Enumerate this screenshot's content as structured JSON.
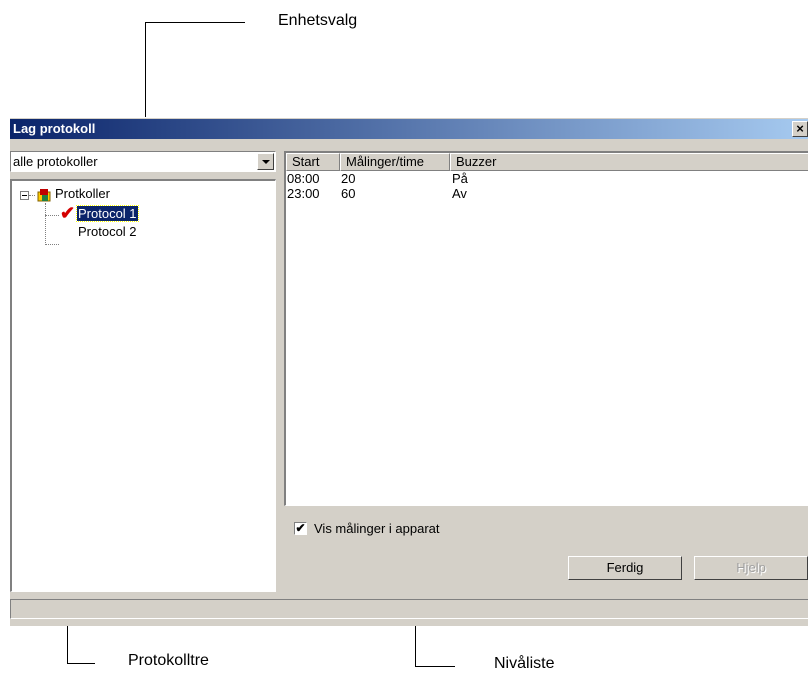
{
  "callouts": {
    "unit_select": "Enhetsvalg",
    "protocol_tree": "Protokolltre",
    "level_list": "Nivåliste"
  },
  "window": {
    "title": "Lag protokoll",
    "close_label": "×"
  },
  "combo": {
    "selected": "alle protokoller"
  },
  "tree": {
    "root_label": "Protkoller",
    "items": [
      {
        "label": "Protocol 1",
        "selected": true,
        "checked": true
      },
      {
        "label": "Protocol 2",
        "selected": false,
        "checked": false
      }
    ]
  },
  "listview": {
    "columns": [
      "Start",
      "Målinger/time",
      "Buzzer"
    ],
    "rows": [
      [
        "08:00",
        "20",
        "På"
      ],
      [
        "23:00",
        "60",
        "Av"
      ]
    ]
  },
  "options": {
    "show_measurements_label": "Vis målinger i apparat",
    "show_measurements_checked": true
  },
  "buttons": {
    "done": "Ferdig",
    "help": "Hjelp"
  },
  "colors": {
    "titlebar_start": "#0a246a",
    "titlebar_end": "#a6caf0",
    "dialog_bg": "#d4d0c8",
    "check_mark": "#d40000"
  }
}
